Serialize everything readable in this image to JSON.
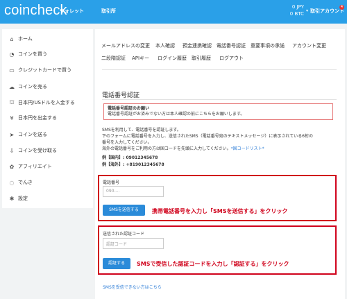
{
  "header": {
    "logo": "coincheck",
    "nav": [
      "ウォレット",
      "取引所"
    ],
    "balance": [
      "0 JPY",
      "0 BTC"
    ],
    "balance_caret": "▾",
    "account": "取引アカウント",
    "notification_count": "4",
    "colors": {
      "bar": "#2aa0e8"
    }
  },
  "sidebar": {
    "items": [
      {
        "label": "ホーム",
        "icon": "home-icon",
        "glyph": "⌂"
      },
      {
        "label": "コインを買う",
        "icon": "cart-icon",
        "glyph": "◔"
      },
      {
        "label": "クレジットカードで買う",
        "icon": "credit-card-icon",
        "glyph": "▭"
      },
      {
        "label": "コインを売る",
        "icon": "cloud-icon",
        "glyph": "☁"
      },
      {
        "label": "日本円/USドルを入金する",
        "icon": "bank-icon",
        "glyph": "⛫"
      },
      {
        "label": "日本円を出金する",
        "icon": "yen-icon",
        "glyph": "¥"
      },
      {
        "label": "コインを送る",
        "icon": "send-icon",
        "glyph": "➤"
      },
      {
        "label": "コインを受け取る",
        "icon": "download-icon",
        "glyph": "⇩"
      },
      {
        "label": "アフィリエイト",
        "icon": "gift-icon",
        "glyph": "✿"
      },
      {
        "label": "でんき",
        "icon": "bulb-icon",
        "glyph": "◌"
      },
      {
        "label": "設定",
        "icon": "gear-icon",
        "glyph": "✱"
      }
    ]
  },
  "tabs": [
    "メールアドレスの変更",
    "本人確認",
    "預金連携確認",
    "電話番号認証",
    "重要事項の承諾",
    "アカウント変更",
    "二段階認証",
    "APIキー",
    "ログイン履歴",
    "取引履歴",
    "ログアウト"
  ],
  "page": {
    "title": "電話番号認証",
    "notice_title": "電話番号認証のお願い",
    "notice_body": "電話番号認証がお済みでない方は本人確認の前にこちらをお願いします。",
    "desc_1": "SMSを利用して、電話番号を認証します。",
    "desc_2": "下のフォームに電話番号を入力し、送信されたSMS（電話番号宛のテキストメッセージ）に表示されている6桁の",
    "desc_3": "番号を入力してください。",
    "desc_4": "海外の電話番号をご利用の方は国コードを先頭に入力してください。",
    "country_list_link": "*国コードリスト*",
    "example_domestic": "例【国内】: 09012345678",
    "example_overseas": "例【海外】: +819012345678",
    "phone_label": "電話番号",
    "phone_placeholder": "090-...",
    "send_sms_button": "SMSを送信する",
    "annot_send": "携帯電話番号を入力し「SMSを送信する」をクリック",
    "code_label": "送信された認証コード",
    "code_placeholder": "認証コード",
    "verify_button": "認証する",
    "annot_verify": "SMSで受信した認証コードを入力し「認証する」をクリック",
    "no_sms_link": "SMSを受信できない方はこちら"
  }
}
